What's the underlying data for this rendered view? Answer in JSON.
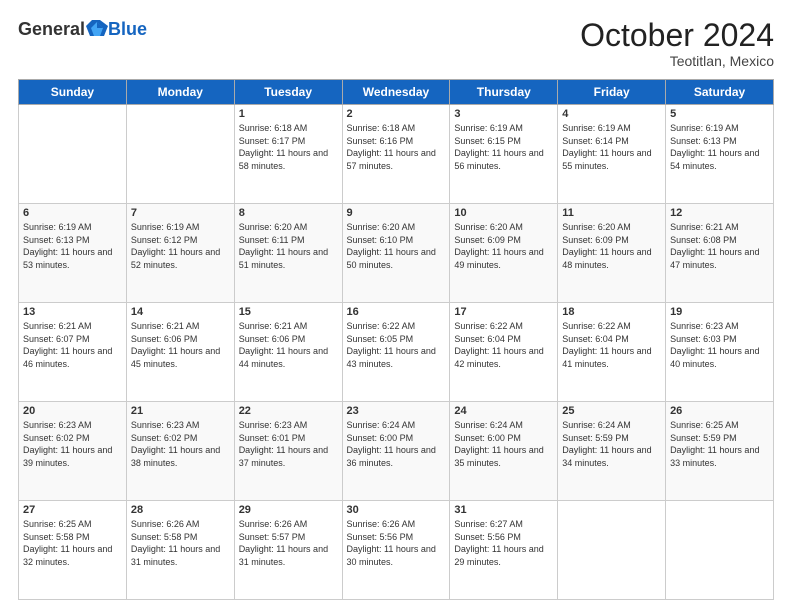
{
  "logo": {
    "general": "General",
    "blue": "Blue"
  },
  "header": {
    "month": "October 2024",
    "location": "Teotitlan, Mexico"
  },
  "days_of_week": [
    "Sunday",
    "Monday",
    "Tuesday",
    "Wednesday",
    "Thursday",
    "Friday",
    "Saturday"
  ],
  "weeks": [
    [
      {
        "day": "",
        "info": ""
      },
      {
        "day": "",
        "info": ""
      },
      {
        "day": "1",
        "info": "Sunrise: 6:18 AM\nSunset: 6:17 PM\nDaylight: 11 hours and 58 minutes."
      },
      {
        "day": "2",
        "info": "Sunrise: 6:18 AM\nSunset: 6:16 PM\nDaylight: 11 hours and 57 minutes."
      },
      {
        "day": "3",
        "info": "Sunrise: 6:19 AM\nSunset: 6:15 PM\nDaylight: 11 hours and 56 minutes."
      },
      {
        "day": "4",
        "info": "Sunrise: 6:19 AM\nSunset: 6:14 PM\nDaylight: 11 hours and 55 minutes."
      },
      {
        "day": "5",
        "info": "Sunrise: 6:19 AM\nSunset: 6:13 PM\nDaylight: 11 hours and 54 minutes."
      }
    ],
    [
      {
        "day": "6",
        "info": "Sunrise: 6:19 AM\nSunset: 6:13 PM\nDaylight: 11 hours and 53 minutes."
      },
      {
        "day": "7",
        "info": "Sunrise: 6:19 AM\nSunset: 6:12 PM\nDaylight: 11 hours and 52 minutes."
      },
      {
        "day": "8",
        "info": "Sunrise: 6:20 AM\nSunset: 6:11 PM\nDaylight: 11 hours and 51 minutes."
      },
      {
        "day": "9",
        "info": "Sunrise: 6:20 AM\nSunset: 6:10 PM\nDaylight: 11 hours and 50 minutes."
      },
      {
        "day": "10",
        "info": "Sunrise: 6:20 AM\nSunset: 6:09 PM\nDaylight: 11 hours and 49 minutes."
      },
      {
        "day": "11",
        "info": "Sunrise: 6:20 AM\nSunset: 6:09 PM\nDaylight: 11 hours and 48 minutes."
      },
      {
        "day": "12",
        "info": "Sunrise: 6:21 AM\nSunset: 6:08 PM\nDaylight: 11 hours and 47 minutes."
      }
    ],
    [
      {
        "day": "13",
        "info": "Sunrise: 6:21 AM\nSunset: 6:07 PM\nDaylight: 11 hours and 46 minutes."
      },
      {
        "day": "14",
        "info": "Sunrise: 6:21 AM\nSunset: 6:06 PM\nDaylight: 11 hours and 45 minutes."
      },
      {
        "day": "15",
        "info": "Sunrise: 6:21 AM\nSunset: 6:06 PM\nDaylight: 11 hours and 44 minutes."
      },
      {
        "day": "16",
        "info": "Sunrise: 6:22 AM\nSunset: 6:05 PM\nDaylight: 11 hours and 43 minutes."
      },
      {
        "day": "17",
        "info": "Sunrise: 6:22 AM\nSunset: 6:04 PM\nDaylight: 11 hours and 42 minutes."
      },
      {
        "day": "18",
        "info": "Sunrise: 6:22 AM\nSunset: 6:04 PM\nDaylight: 11 hours and 41 minutes."
      },
      {
        "day": "19",
        "info": "Sunrise: 6:23 AM\nSunset: 6:03 PM\nDaylight: 11 hours and 40 minutes."
      }
    ],
    [
      {
        "day": "20",
        "info": "Sunrise: 6:23 AM\nSunset: 6:02 PM\nDaylight: 11 hours and 39 minutes."
      },
      {
        "day": "21",
        "info": "Sunrise: 6:23 AM\nSunset: 6:02 PM\nDaylight: 11 hours and 38 minutes."
      },
      {
        "day": "22",
        "info": "Sunrise: 6:23 AM\nSunset: 6:01 PM\nDaylight: 11 hours and 37 minutes."
      },
      {
        "day": "23",
        "info": "Sunrise: 6:24 AM\nSunset: 6:00 PM\nDaylight: 11 hours and 36 minutes."
      },
      {
        "day": "24",
        "info": "Sunrise: 6:24 AM\nSunset: 6:00 PM\nDaylight: 11 hours and 35 minutes."
      },
      {
        "day": "25",
        "info": "Sunrise: 6:24 AM\nSunset: 5:59 PM\nDaylight: 11 hours and 34 minutes."
      },
      {
        "day": "26",
        "info": "Sunrise: 6:25 AM\nSunset: 5:59 PM\nDaylight: 11 hours and 33 minutes."
      }
    ],
    [
      {
        "day": "27",
        "info": "Sunrise: 6:25 AM\nSunset: 5:58 PM\nDaylight: 11 hours and 32 minutes."
      },
      {
        "day": "28",
        "info": "Sunrise: 6:26 AM\nSunset: 5:58 PM\nDaylight: 11 hours and 31 minutes."
      },
      {
        "day": "29",
        "info": "Sunrise: 6:26 AM\nSunset: 5:57 PM\nDaylight: 11 hours and 31 minutes."
      },
      {
        "day": "30",
        "info": "Sunrise: 6:26 AM\nSunset: 5:56 PM\nDaylight: 11 hours and 30 minutes."
      },
      {
        "day": "31",
        "info": "Sunrise: 6:27 AM\nSunset: 5:56 PM\nDaylight: 11 hours and 29 minutes."
      },
      {
        "day": "",
        "info": ""
      },
      {
        "day": "",
        "info": ""
      }
    ]
  ]
}
